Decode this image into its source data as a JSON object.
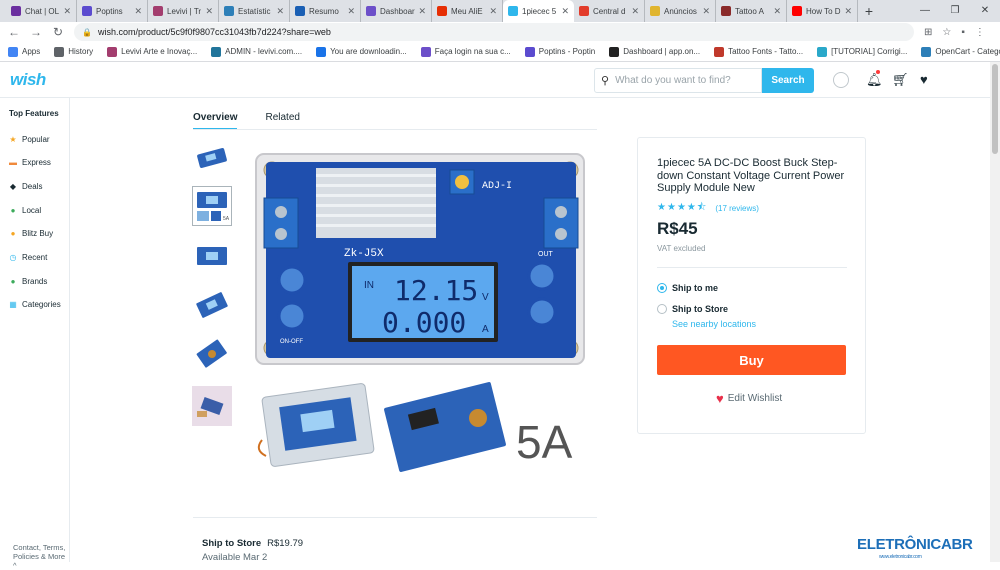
{
  "browser": {
    "tabs": [
      {
        "title": "Chat | OL",
        "color": "#6b2fa0"
      },
      {
        "title": "Poptins",
        "color": "#5b4bcf"
      },
      {
        "title": "Levivi | Tr",
        "color": "#a33d6e"
      },
      {
        "title": "Estatístic",
        "color": "#2d7fb8"
      },
      {
        "title": "Resumo",
        "color": "#1a5fb4"
      },
      {
        "title": "Dashboar",
        "color": "#6c4fc9"
      },
      {
        "title": "Meu AliE",
        "color": "#e62e04"
      },
      {
        "title": "1piecec 5",
        "color": "#2fb7ec",
        "active": true
      },
      {
        "title": "Central d",
        "color": "#e23c2b"
      },
      {
        "title": "Anúncios",
        "color": "#e0b52f"
      },
      {
        "title": "Tattoo A",
        "color": "#8a2a2a"
      },
      {
        "title": "How To D",
        "color": "#ff0000"
      }
    ],
    "url": "wish.com/product/5c9f0f9807cc31043fb7d224?share=web",
    "bookmarks": [
      {
        "label": "Apps",
        "color": "#4285f4"
      },
      {
        "label": "History",
        "color": "#5f6368"
      },
      {
        "label": "Levivi Arte e Inovaç...",
        "color": "#a33d6e"
      },
      {
        "label": "ADMIN - levivi.com....",
        "color": "#21759b"
      },
      {
        "label": "You are downloadin...",
        "color": "#1a73e8"
      },
      {
        "label": "Faça login na sua c...",
        "color": "#6c4fc9"
      },
      {
        "label": "Poptins - Poptin",
        "color": "#5b4bcf"
      },
      {
        "label": "Dashboard | app.on...",
        "color": "#222222"
      },
      {
        "label": "Tattoo Fonts - Tatto...",
        "color": "#c0392b"
      },
      {
        "label": "[TUTORIAL] Corrigi...",
        "color": "#2aa8c9"
      },
      {
        "label": "OpenCart - Categor...",
        "color": "#2d7fb8"
      }
    ]
  },
  "wish": {
    "logo": "wish",
    "search_placeholder": "What do you want to find?",
    "search_button": "Search"
  },
  "sidebar": {
    "title": "Top Features",
    "items": [
      {
        "label": "Popular",
        "icon": "star-icon",
        "color": "#f5a623",
        "glyph": "★"
      },
      {
        "label": "Express",
        "icon": "truck-icon",
        "color": "#f08a3c",
        "glyph": "▬"
      },
      {
        "label": "Deals",
        "icon": "tag-icon",
        "color": "#192a32",
        "glyph": "◆"
      },
      {
        "label": "Local",
        "icon": "pin-icon",
        "color": "#3dab5c",
        "glyph": "●"
      },
      {
        "label": "Blitz Buy",
        "icon": "blitz-icon",
        "color": "#f5a623",
        "glyph": "●"
      },
      {
        "label": "Recent",
        "icon": "clock-icon",
        "color": "#2fb7ec",
        "glyph": "◷"
      },
      {
        "label": "Brands",
        "icon": "brand-badge-icon",
        "color": "#3dab5c",
        "glyph": "●"
      },
      {
        "label": "Categories",
        "icon": "grid-icon",
        "color": "#2fb7ec",
        "glyph": "▦"
      }
    ],
    "footer": "Contact, Terms, Policies & More ^"
  },
  "product": {
    "tabs": [
      "Overview",
      "Related"
    ],
    "title": "1piecec 5A DC-DC Boost Buck Step-down Constant Voltage Current Power Supply Module New",
    "rating": 4.5,
    "reviews": "(17 reviews)",
    "price": "R$45",
    "vat": "VAT excluded",
    "ship_to_me": "Ship to me",
    "ship_to_store": "Ship to Store",
    "nearby": "See nearby locations",
    "buy": "Buy",
    "wishlist": "Edit Wishlist",
    "image_text": {
      "adj": "ADJ-I",
      "model": "Zk-J5X",
      "voltage": "12.15",
      "voltage_unit": "V",
      "current": "0.000",
      "current_unit": "A",
      "rating_label": "5A",
      "out": "OUT",
      "in": "IN",
      "onoff": "ON-OFF"
    }
  },
  "shipping": {
    "label": "Ship to Store",
    "price": "R$19.79",
    "available": "Available Mar 2"
  },
  "watermark": {
    "brand": "ELETRÔNICABR",
    "url": "www.eletronicabr.com"
  }
}
